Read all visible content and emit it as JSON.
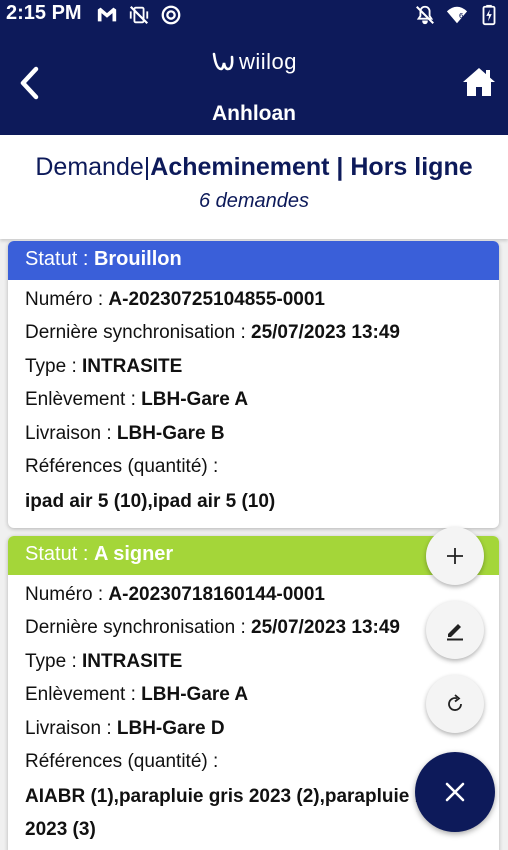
{
  "status_bar": {
    "time": "2:15 PM",
    "left_icons": [
      "gmail-icon",
      "vibrate-off-icon",
      "sync-icon"
    ],
    "right_icons": [
      "notifications-off-icon",
      "wifi-6-icon",
      "battery-charging-icon"
    ]
  },
  "app_bar": {
    "logo_text": "wiilog",
    "title": "Anhloan",
    "back_icon": "chevron-left-icon",
    "home_icon": "home-icon"
  },
  "header": {
    "part1": "Demande",
    "separator1": "|",
    "part2": "Acheminement",
    "separator2": " | ",
    "part3": "Hors ligne",
    "count": "6 demandes"
  },
  "labels": {
    "statut": "Statut : ",
    "numero": "Numéro : ",
    "sync": "Dernière synchronisation : ",
    "type": "Type : ",
    "pickup": "Enlèvement : ",
    "delivery": "Livraison : ",
    "refs": "Références (quantité) :"
  },
  "cards": [
    {
      "status": "Brouillon",
      "status_color": "#3a5fd9",
      "numero": "A-20230725104855-0001",
      "sync": "25/07/2023 13:49",
      "type": "INTRASITE",
      "pickup": "LBH-Gare A",
      "delivery": "LBH-Gare B",
      "refs": "ipad air 5 (10),ipad air 5 (10)"
    },
    {
      "status": "A signer",
      "status_color": "#a4d639",
      "numero": "A-20230718160144-0001",
      "sync": "25/07/2023 13:49",
      "type": "INTRASITE",
      "pickup": "LBH-Gare A",
      "delivery": "LBH-Gare D",
      "refs": "AIABR (1),parapluie gris 2023 (2),parapluie bleu 2023 (3)"
    }
  ],
  "fab": {
    "add_icon": "plus-icon",
    "edit_icon": "pencil-icon",
    "refresh_icon": "refresh-icon",
    "close_icon": "close-icon"
  },
  "colors": {
    "primary": "#0d1a5a",
    "draft": "#3a5fd9",
    "to_sign": "#a4d639"
  }
}
